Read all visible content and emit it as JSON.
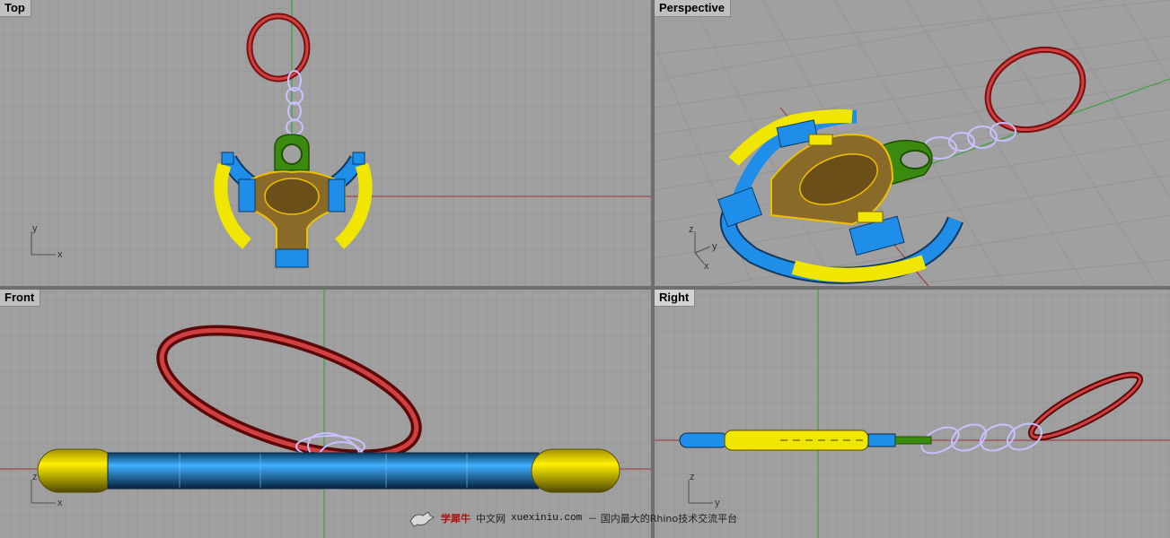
{
  "viewports": {
    "top": {
      "label": "Top"
    },
    "perspective": {
      "label": "Perspective"
    },
    "front": {
      "label": "Front"
    },
    "right": {
      "label": "Right"
    }
  },
  "axes": {
    "top": {
      "a": "y",
      "b": "x"
    },
    "perspective": {
      "a": "z",
      "b": "y",
      "c": "x"
    },
    "front": {
      "a": "z",
      "b": "x"
    },
    "right": {
      "a": "z",
      "b": "y"
    }
  },
  "watermark": {
    "brand": "学犀牛",
    "site_cn": "中文网",
    "url": "xuexiniu.com",
    "tagline": "－ 国内最大的Rhino技术交流平台"
  },
  "colors": {
    "viewport_bg": "#a0a0a0",
    "grid_minor": "#959595",
    "grid_major": "#8a8a8a",
    "axis_red": "#a03030",
    "axis_green": "#30a030",
    "ring_red": "#c83232",
    "wheel_yellow": "#f0e600",
    "wheel_blue": "#1e8ee8",
    "hub_brown": "#8a6a28",
    "mount_green": "#3a8a10",
    "chain_lilac": "#c8c0ff"
  }
}
